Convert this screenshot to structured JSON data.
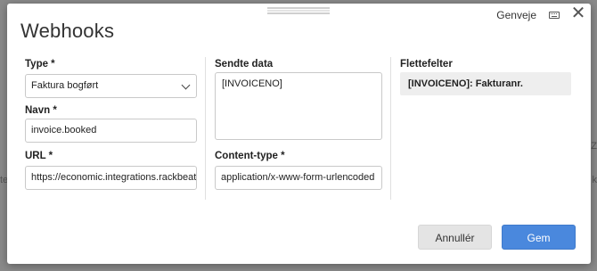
{
  "dialog": {
    "title": "Webhooks",
    "shortcuts_label": "Genveje",
    "keyboard_icon": "keyboard-icon",
    "close_icon": "close-icon",
    "close_glyph": "✕"
  },
  "form": {
    "type": {
      "label": "Type *",
      "value": "Faktura bogført"
    },
    "name": {
      "label": "Navn *",
      "value": "invoice.booked"
    },
    "url": {
      "label": "URL *",
      "value": "https://economic.integrations.rackbeat.c"
    },
    "sent_data": {
      "label": "Sendte data",
      "value": "[INVOICENO]"
    },
    "content_type": {
      "label": "Content-type *",
      "value": "application/x-www-form-urlencoded"
    }
  },
  "merge_fields": {
    "label": "Flettefelter",
    "items": [
      "[INVOICENO]: Fakturanr."
    ]
  },
  "buttons": {
    "cancel": "Annullér",
    "save": "Gem"
  },
  "colors": {
    "primary": "#4a88dd",
    "secondary": "#e4e4e4",
    "chip": "#eeeeee"
  }
}
